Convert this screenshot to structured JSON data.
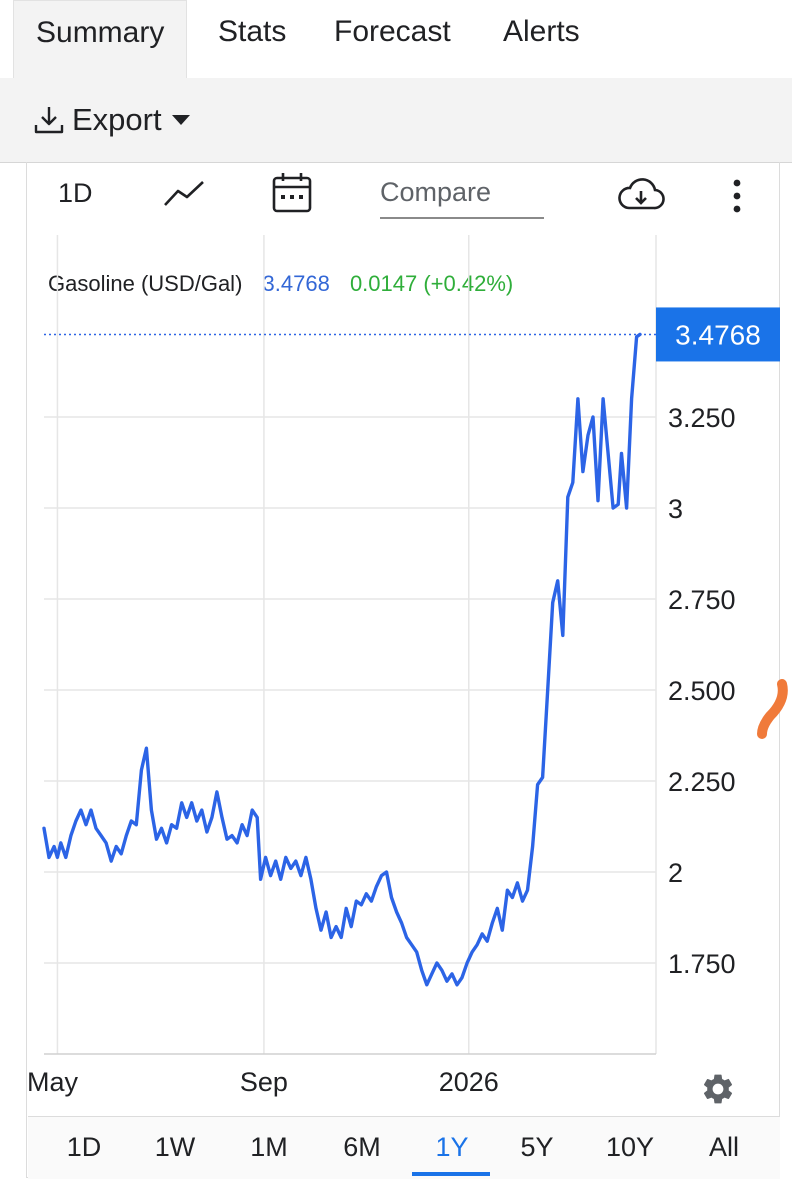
{
  "tabs": [
    {
      "label": "Summary",
      "active": true
    },
    {
      "label": "Stats"
    },
    {
      "label": "Forecast"
    },
    {
      "label": "Alerts"
    }
  ],
  "toolbar": {
    "export_label": "Export"
  },
  "chart_controls": {
    "interval_label": "1D",
    "compare_placeholder": "Compare",
    "icons": [
      "line-chart-icon",
      "calendar-icon",
      "cloud-download-icon",
      "more-vert-icon",
      "gear-icon"
    ]
  },
  "legend": {
    "name": "Gasoline (USD/Gal)",
    "value": "3.4768",
    "change": "0.0147 (+0.42%)",
    "value_color": "#3367d6",
    "change_color": "#2fae3a"
  },
  "price_tag": "3.4768",
  "ranges": [
    "1D",
    "1W",
    "1M",
    "6M",
    "1Y",
    "5Y",
    "10Y",
    "All"
  ],
  "active_range": "1Y",
  "colors": {
    "line": "#2c64e6",
    "accent": "#1a73e8",
    "grid": "#e6e6e6"
  },
  "chart_data": {
    "type": "line",
    "title": "",
    "xlabel": "",
    "ylabel": "",
    "series": [
      {
        "name": "Gasoline (USD/Gal)",
        "unit": "USD/Gal"
      }
    ],
    "x_tick_labels": [
      "May",
      "Sep",
      "2026"
    ],
    "y_tick_labels": [
      "1.750",
      "2",
      "2.250",
      "2.500",
      "2.750",
      "3",
      "3.250"
    ],
    "y_ticks": [
      1.75,
      2.0,
      2.25,
      2.5,
      2.75,
      3.0,
      3.25
    ],
    "ylim": [
      1.5,
      3.55
    ],
    "x_ticks": [
      "2025-05-01",
      "2025-09-01",
      "2026-01-01"
    ],
    "points": [
      [
        "2025-04-23",
        2.12
      ],
      [
        "2025-04-26",
        2.04
      ],
      [
        "2025-04-29",
        2.07
      ],
      [
        "2025-05-01",
        2.04
      ],
      [
        "2025-05-03",
        2.08
      ],
      [
        "2025-05-06",
        2.04
      ],
      [
        "2025-05-09",
        2.1
      ],
      [
        "2025-05-12",
        2.14
      ],
      [
        "2025-05-15",
        2.17
      ],
      [
        "2025-05-18",
        2.13
      ],
      [
        "2025-05-21",
        2.17
      ],
      [
        "2025-05-24",
        2.12
      ],
      [
        "2025-05-27",
        2.1
      ],
      [
        "2025-05-30",
        2.08
      ],
      [
        "2025-06-02",
        2.03
      ],
      [
        "2025-06-05",
        2.07
      ],
      [
        "2025-06-08",
        2.05
      ],
      [
        "2025-06-11",
        2.1
      ],
      [
        "2025-06-14",
        2.14
      ],
      [
        "2025-06-17",
        2.13
      ],
      [
        "2025-06-20",
        2.28
      ],
      [
        "2025-06-23",
        2.34
      ],
      [
        "2025-06-26",
        2.17
      ],
      [
        "2025-06-29",
        2.09
      ],
      [
        "2025-07-02",
        2.12
      ],
      [
        "2025-07-05",
        2.08
      ],
      [
        "2025-07-08",
        2.13
      ],
      [
        "2025-07-11",
        2.12
      ],
      [
        "2025-07-14",
        2.19
      ],
      [
        "2025-07-17",
        2.15
      ],
      [
        "2025-07-20",
        2.19
      ],
      [
        "2025-07-23",
        2.14
      ],
      [
        "2025-07-26",
        2.17
      ],
      [
        "2025-07-29",
        2.11
      ],
      [
        "2025-08-01",
        2.15
      ],
      [
        "2025-08-04",
        2.22
      ],
      [
        "2025-08-07",
        2.15
      ],
      [
        "2025-08-10",
        2.09
      ],
      [
        "2025-08-13",
        2.1
      ],
      [
        "2025-08-16",
        2.08
      ],
      [
        "2025-08-19",
        2.13
      ],
      [
        "2025-08-22",
        2.1
      ],
      [
        "2025-08-25",
        2.17
      ],
      [
        "2025-08-28",
        2.15
      ],
      [
        "2025-08-30",
        1.98
      ],
      [
        "2025-09-02",
        2.04
      ],
      [
        "2025-09-05",
        1.99
      ],
      [
        "2025-09-08",
        2.03
      ],
      [
        "2025-09-11",
        1.98
      ],
      [
        "2025-09-14",
        2.04
      ],
      [
        "2025-09-17",
        2.01
      ],
      [
        "2025-09-20",
        2.03
      ],
      [
        "2025-09-23",
        1.99
      ],
      [
        "2025-09-26",
        2.04
      ],
      [
        "2025-09-29",
        1.98
      ],
      [
        "2025-10-02",
        1.9
      ],
      [
        "2025-10-05",
        1.84
      ],
      [
        "2025-10-08",
        1.89
      ],
      [
        "2025-10-11",
        1.82
      ],
      [
        "2025-10-14",
        1.85
      ],
      [
        "2025-10-17",
        1.82
      ],
      [
        "2025-10-20",
        1.9
      ],
      [
        "2025-10-23",
        1.85
      ],
      [
        "2025-10-26",
        1.92
      ],
      [
        "2025-10-29",
        1.91
      ],
      [
        "2025-11-01",
        1.94
      ],
      [
        "2025-11-04",
        1.92
      ],
      [
        "2025-11-07",
        1.96
      ],
      [
        "2025-11-10",
        1.99
      ],
      [
        "2025-11-13",
        2.0
      ],
      [
        "2025-11-16",
        1.93
      ],
      [
        "2025-11-19",
        1.89
      ],
      [
        "2025-11-22",
        1.86
      ],
      [
        "2025-11-25",
        1.82
      ],
      [
        "2025-11-28",
        1.8
      ],
      [
        "2025-12-01",
        1.78
      ],
      [
        "2025-12-04",
        1.73
      ],
      [
        "2025-12-07",
        1.69
      ],
      [
        "2025-12-10",
        1.72
      ],
      [
        "2025-12-13",
        1.75
      ],
      [
        "2025-12-16",
        1.73
      ],
      [
        "2025-12-19",
        1.7
      ],
      [
        "2025-12-22",
        1.72
      ],
      [
        "2025-12-25",
        1.69
      ],
      [
        "2025-12-28",
        1.71
      ],
      [
        "2025-12-31",
        1.75
      ],
      [
        "2026-01-03",
        1.78
      ],
      [
        "2026-01-06",
        1.8
      ],
      [
        "2026-01-09",
        1.83
      ],
      [
        "2026-01-12",
        1.81
      ],
      [
        "2026-01-15",
        1.86
      ],
      [
        "2026-01-18",
        1.9
      ],
      [
        "2026-01-21",
        1.84
      ],
      [
        "2026-01-24",
        1.95
      ],
      [
        "2026-01-27",
        1.93
      ],
      [
        "2026-01-30",
        1.97
      ],
      [
        "2026-02-02",
        1.92
      ],
      [
        "2026-02-05",
        1.95
      ],
      [
        "2026-02-08",
        2.07
      ],
      [
        "2026-02-11",
        2.24
      ],
      [
        "2026-02-14",
        2.26
      ],
      [
        "2026-02-17",
        2.5
      ],
      [
        "2026-02-20",
        2.74
      ],
      [
        "2026-02-23",
        2.8
      ],
      [
        "2026-02-26",
        2.65
      ],
      [
        "2026-03-01",
        3.03
      ],
      [
        "2026-03-04",
        3.07
      ],
      [
        "2026-03-07",
        3.3
      ],
      [
        "2026-03-10",
        3.1
      ],
      [
        "2026-03-13",
        3.2
      ],
      [
        "2026-03-16",
        3.25
      ],
      [
        "2026-03-19",
        3.02
      ],
      [
        "2026-03-22",
        3.3
      ],
      [
        "2026-03-25",
        3.15
      ],
      [
        "2026-03-28",
        3.0
      ],
      [
        "2026-03-31",
        3.01
      ],
      [
        "2026-04-02",
        3.15
      ],
      [
        "2026-04-05",
        3.0
      ],
      [
        "2026-04-08",
        3.3
      ],
      [
        "2026-04-11",
        3.47
      ],
      [
        "2026-04-13",
        3.4768
      ]
    ]
  }
}
